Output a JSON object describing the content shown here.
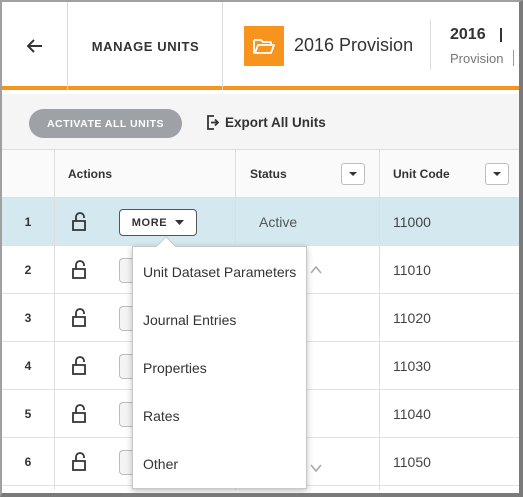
{
  "header": {
    "title": "MANAGE UNITS",
    "provision_name": "2016 Provision",
    "year": "2016",
    "subtitle": "Provision",
    "accent_color": "#f7941d"
  },
  "toolbar": {
    "activate_label": "ACTIVATE ALL UNITS",
    "export_label": "Export All Units"
  },
  "table": {
    "columns": {
      "actions": "Actions",
      "status": "Status",
      "unit_code": "Unit Code"
    },
    "more_label": "MORE",
    "rows": [
      {
        "num": "1",
        "status": "Active",
        "code": "11000",
        "selected": true
      },
      {
        "num": "2",
        "status": "",
        "code": "11010"
      },
      {
        "num": "3",
        "status": "",
        "code": "11020"
      },
      {
        "num": "4",
        "status": "",
        "code": "11030"
      },
      {
        "num": "5",
        "status": "",
        "code": "11040"
      },
      {
        "num": "6",
        "status": "",
        "code": "11050"
      }
    ]
  },
  "more_menu": {
    "items": [
      "Unit Dataset Parameters",
      "Journal Entries",
      "Properties",
      "Rates",
      "Other"
    ]
  },
  "icons": {
    "back": "arrow-left-icon",
    "folder": "folder-open-icon",
    "export": "export-icon",
    "lock": "unlock-icon",
    "sort": "chevron-down-icon"
  }
}
